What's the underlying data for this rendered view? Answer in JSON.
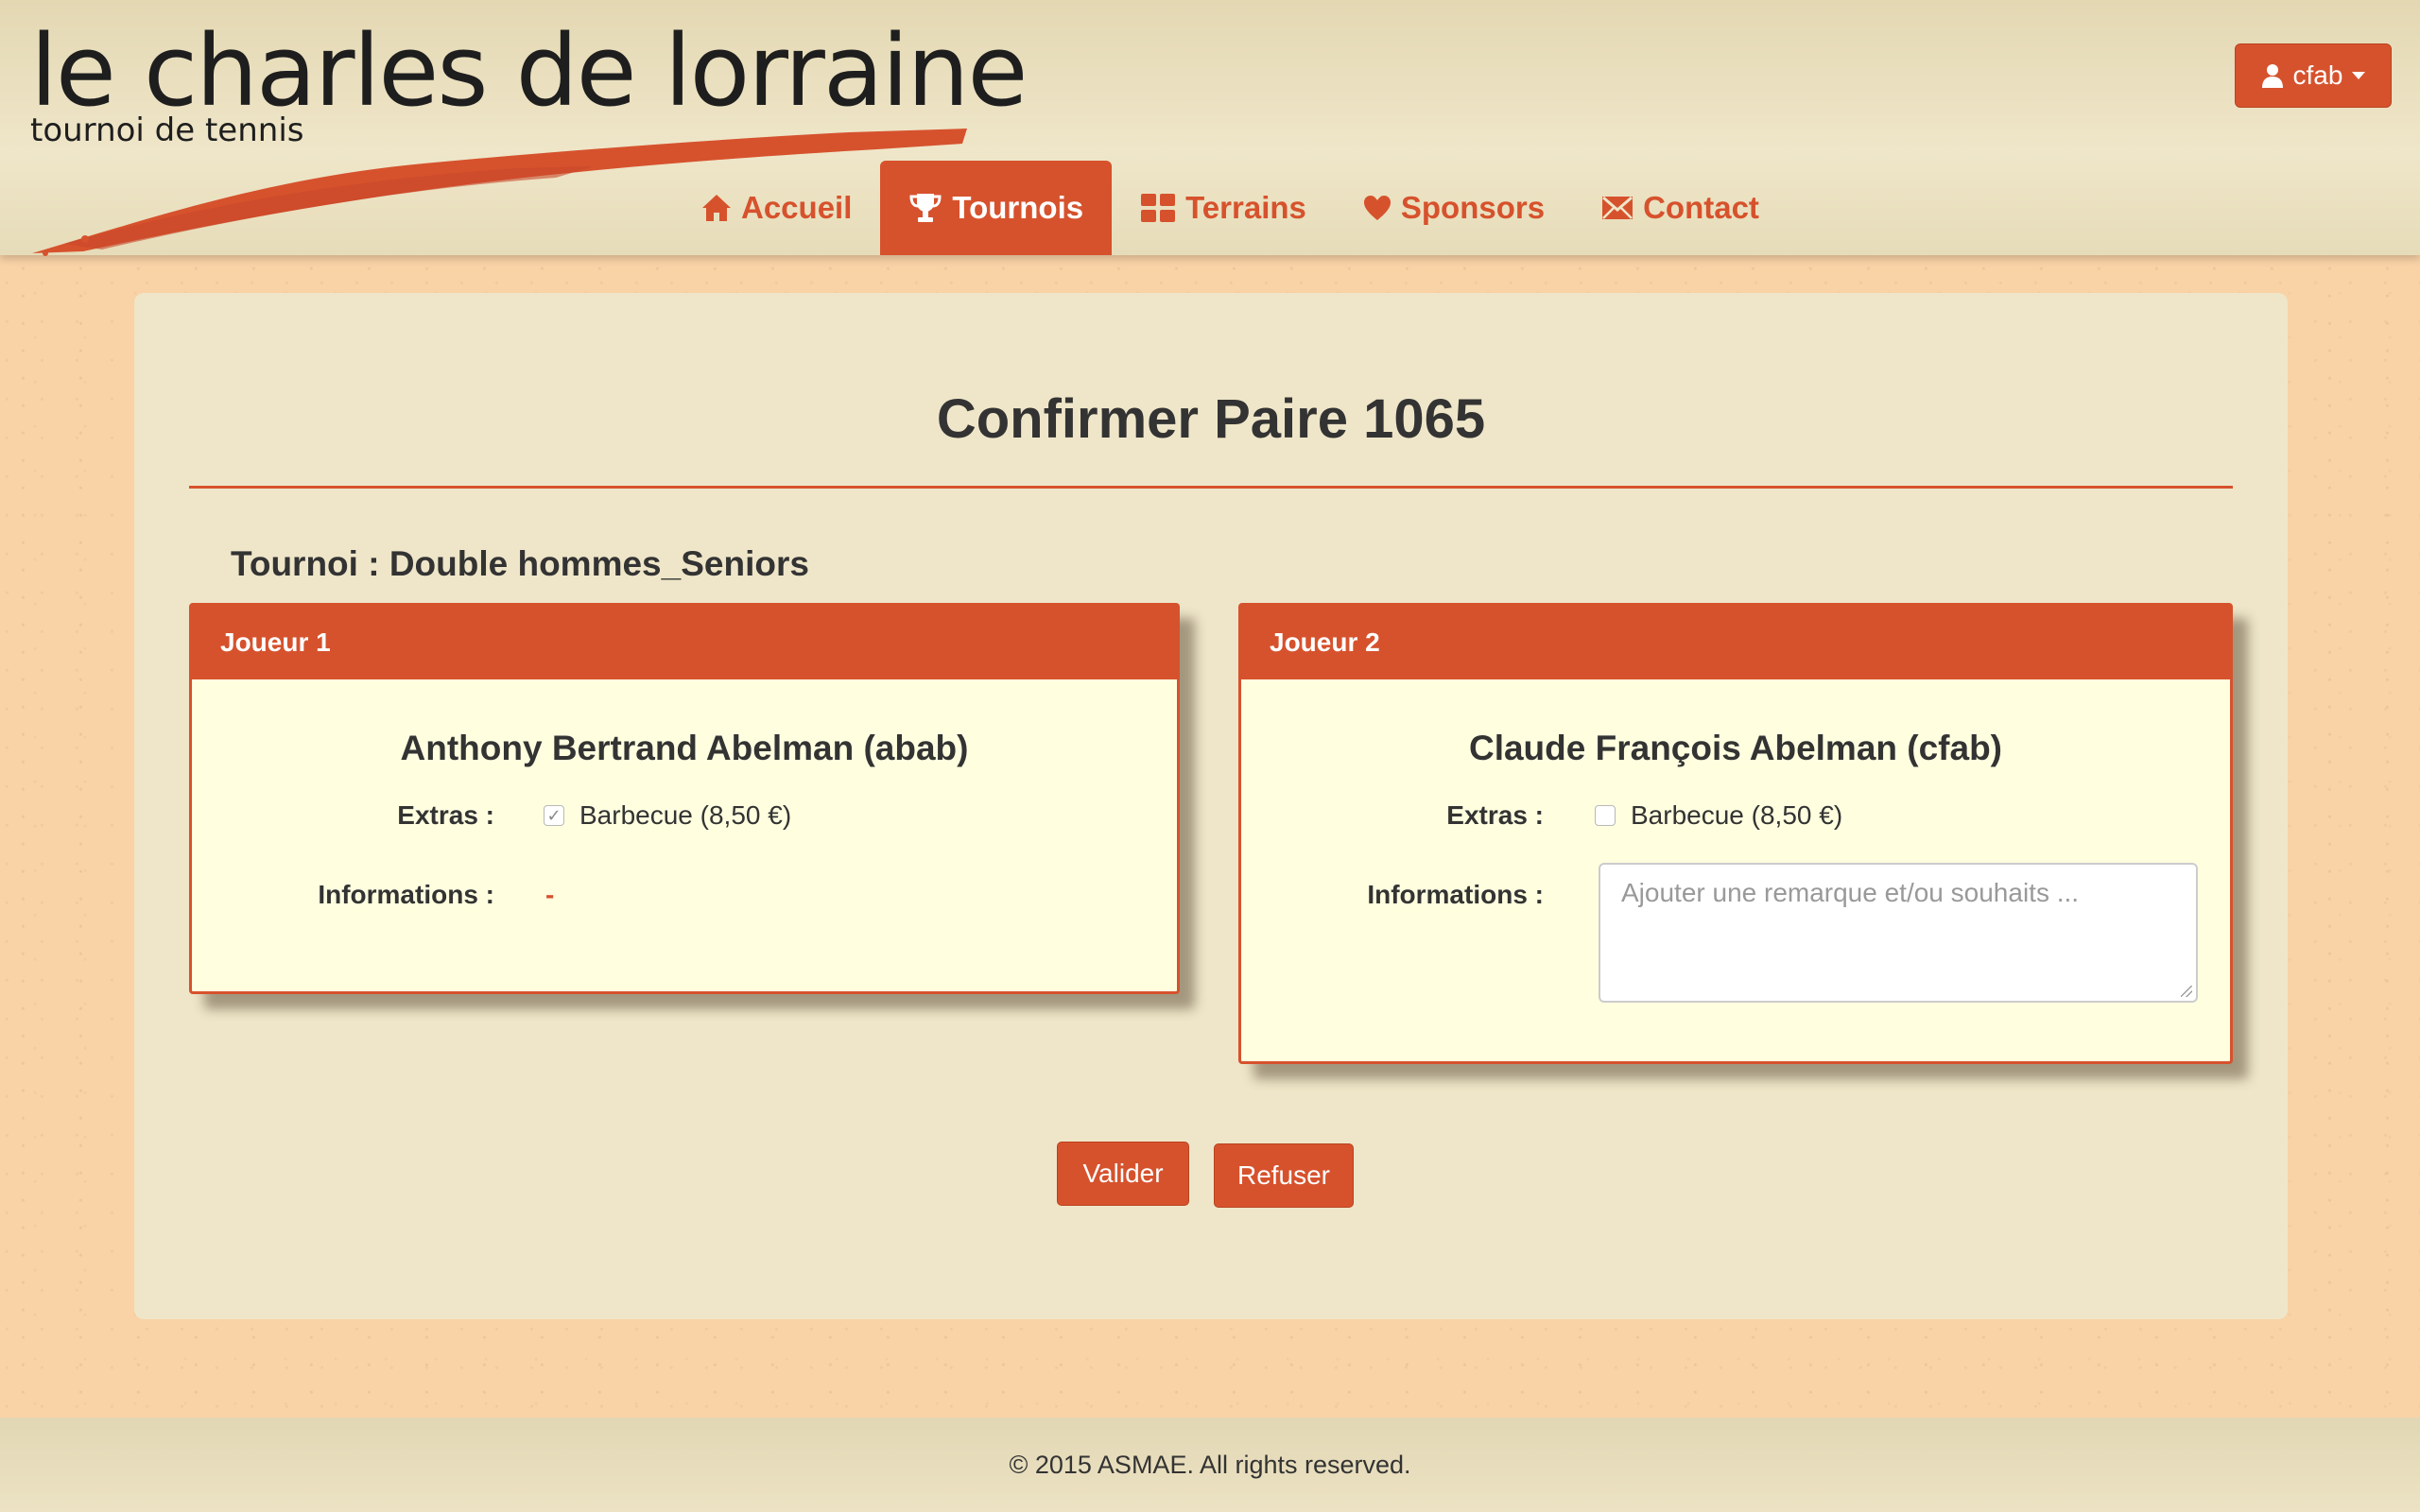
{
  "brand": {
    "title": "le charles de lorraine",
    "subtitle": "tournoi de tennis"
  },
  "user_menu": {
    "username": "cfab",
    "icon": "user-icon"
  },
  "nav": {
    "items": [
      {
        "label": "Accueil",
        "icon": "home-icon",
        "active": false
      },
      {
        "label": "Tournois",
        "icon": "trophy-icon",
        "active": true
      },
      {
        "label": "Terrains",
        "icon": "grid-icon",
        "active": false
      },
      {
        "label": "Sponsors",
        "icon": "heart-icon",
        "active": false
      },
      {
        "label": "Contact",
        "icon": "envelope-icon",
        "active": false
      }
    ]
  },
  "page": {
    "title": "Confirmer Paire 1065",
    "tournoi": "Tournoi : Double hommes_Seniors"
  },
  "players": [
    {
      "heading": "Joueur 1",
      "name": "Anthony Bertrand Abelman (abab)",
      "extras_label": "Extras :",
      "extra_option": "Barbecue (8,50 €)",
      "extra_checked": true,
      "info_label": "Informations :",
      "info_value": "-"
    },
    {
      "heading": "Joueur 2",
      "name": "Claude François Abelman (cfab)",
      "extras_label": "Extras :",
      "extra_option": "Barbecue (8,50 €)",
      "extra_checked": false,
      "info_label": "Informations :",
      "info_placeholder": "Ajouter une remarque et/ou souhaits ..."
    }
  ],
  "actions": {
    "validate": "Valider",
    "refuse": "Refuser"
  },
  "footer": {
    "copyright": "© 2015 ASMAE. All rights reserved."
  },
  "colors": {
    "accent": "#d6522d",
    "panel": "#efe6c9",
    "card": "#ffffe0",
    "background": "#f9d2a6"
  }
}
